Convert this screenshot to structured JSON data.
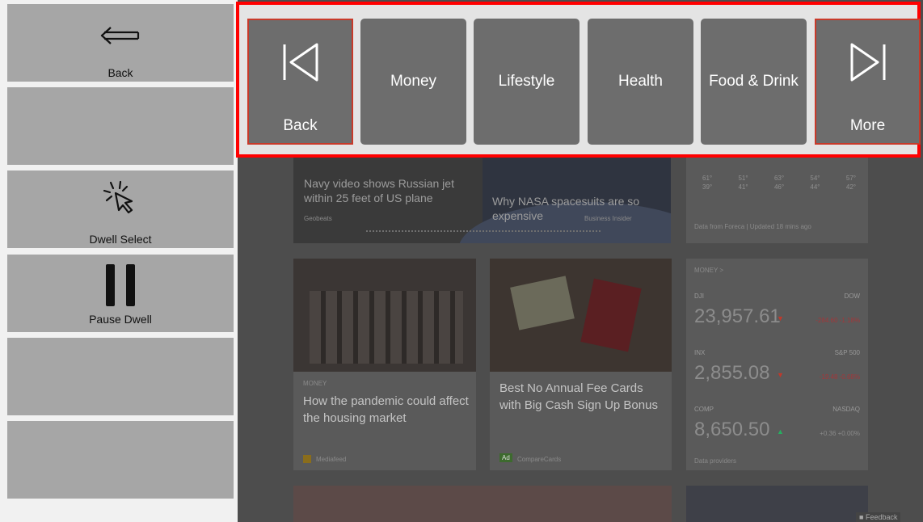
{
  "sidebar": {
    "back_label": "Back",
    "dwell_select_label": "Dwell Select",
    "pause_dwell_label": "Pause Dwell"
  },
  "categories": {
    "back_label": "Back",
    "items": [
      "Money",
      "Lifestyle",
      "Health",
      "Food & Drink"
    ],
    "more_label": "More"
  },
  "news": {
    "hero1_title": "Navy video shows Russian jet within 25 feet of US plane",
    "hero1_source": "Geobeats",
    "hero2_title": "Why NASA spacesuits are so expensive",
    "hero2_source": "Business Insider",
    "card1_category": "MONEY",
    "card1_title": "How the pandemic could affect the housing market",
    "card1_source": "Mediafeed",
    "card2_title": "Best No Annual Fee Cards with Big Cash Sign Up Bonus",
    "card2_ad": "Ad",
    "card2_source": "CompareCards"
  },
  "weather": {
    "highs": [
      "61°",
      "51°",
      "63°",
      "54°",
      "57°"
    ],
    "lows": [
      "39°",
      "41°",
      "46°",
      "44°",
      "42°"
    ],
    "credit": "Data from Foreca | Updated 18 mins ago"
  },
  "money": {
    "header": "MONEY  >",
    "rows": [
      {
        "symbol": "DJI",
        "index": "DOW",
        "value": "23,957.61",
        "arrow": "▼",
        "change": "-284.60 -1.18%"
      },
      {
        "symbol": "INX",
        "index": "S&P 500",
        "value": "2,855.08",
        "arrow": "▼",
        "change": "-19.48 -0.68%"
      },
      {
        "symbol": "COMP",
        "index": "NASDAQ",
        "value": "8,650.50",
        "arrow": "▲",
        "change": "+0.36 +0.00%"
      }
    ],
    "providers": "Data providers"
  },
  "feedback_label": "Feedback",
  "colors": {
    "highlight": "#ff0000",
    "tile": "#6d6d6d",
    "side_tile": "#a6a6a6",
    "down": "#c0392b",
    "up": "#27ae60"
  }
}
